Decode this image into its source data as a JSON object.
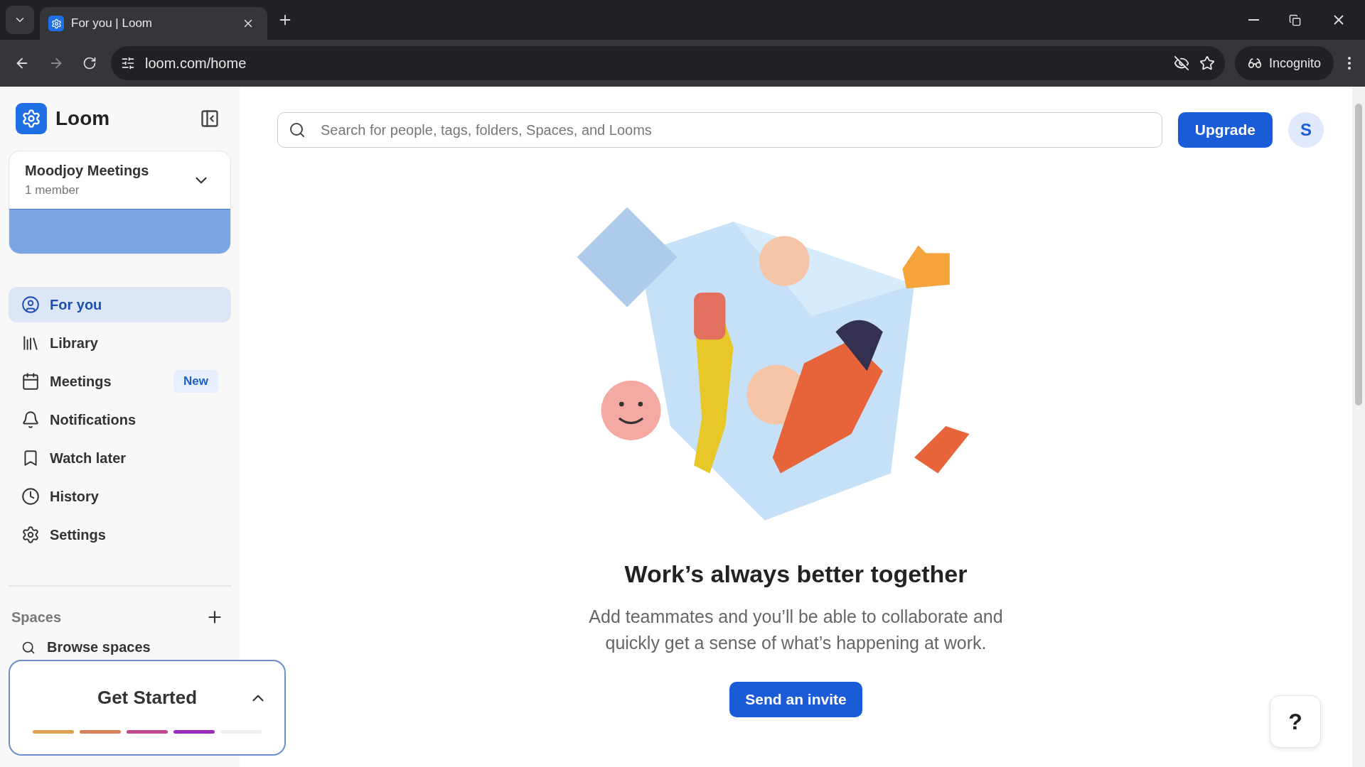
{
  "browser": {
    "tab_title": "For you | Loom",
    "url": "loom.com/home",
    "profile_label": "Incognito"
  },
  "sidebar": {
    "brand": "Loom",
    "workspace": {
      "name": "Moodjoy Meetings",
      "members": "1 member"
    },
    "nav": [
      {
        "label": "For you",
        "selected": true
      },
      {
        "label": "Library",
        "selected": false
      },
      {
        "label": "Meetings",
        "selected": false,
        "badge": "New"
      },
      {
        "label": "Notifications",
        "selected": false
      },
      {
        "label": "Watch later",
        "selected": false
      },
      {
        "label": "History",
        "selected": false
      },
      {
        "label": "Settings",
        "selected": false
      }
    ],
    "spaces_title": "Spaces",
    "spaces_items": [
      {
        "label": "Browse spaces"
      }
    ]
  },
  "get_started": {
    "title": "Get Started",
    "expanded": true,
    "steps": [
      {
        "done": true,
        "color": "#e0a050"
      },
      {
        "done": true,
        "color": "#d9805a"
      },
      {
        "done": true,
        "color": "#c2478c"
      },
      {
        "done": true,
        "color": "#9b2bbf"
      },
      {
        "done": false,
        "color": "#e6e6e6"
      }
    ]
  },
  "search": {
    "placeholder": "Search for people, tags, folders, Spaces, and Looms"
  },
  "upgrade_label": "Upgrade",
  "avatar_initial": "S",
  "empty_state": {
    "title": "Work’s always better together",
    "lines": [
      "Add teammates and you’ll be able to collaborate and",
      "quickly get a sense of what’s happening at work."
    ],
    "button": "Send an invite"
  },
  "help_label": "?"
}
